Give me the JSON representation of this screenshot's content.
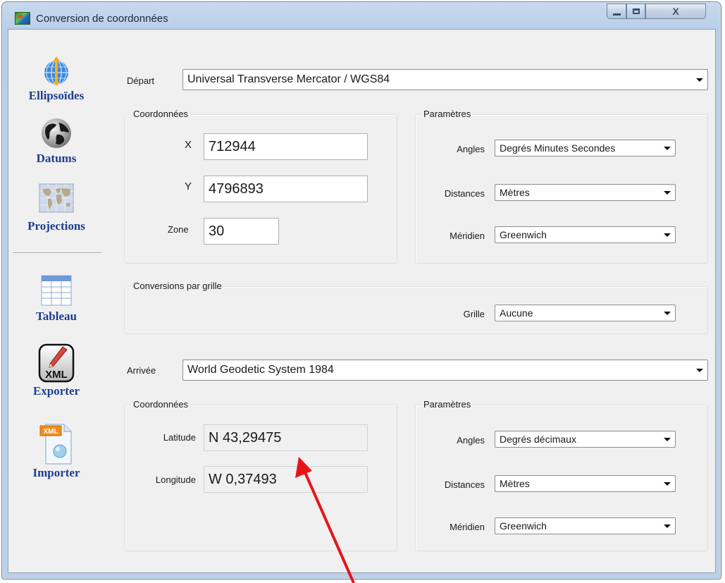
{
  "window": {
    "title": "Conversion de coordonnées",
    "close_glyph": "X"
  },
  "sidebar": {
    "items": [
      {
        "label": "Ellipsoïdes",
        "icon": "globe-axis-icon"
      },
      {
        "label": "Datums",
        "icon": "earth-globe-icon"
      },
      {
        "label": "Projections",
        "icon": "world-map-icon"
      },
      {
        "label": "Tableau",
        "icon": "table-icon"
      },
      {
        "label": "Exporter",
        "icon": "xml-pen-icon"
      },
      {
        "label": "Importer",
        "icon": "xml-document-icon"
      }
    ],
    "xml_badge": "XML",
    "xml_doc_badge": "XML"
  },
  "depart": {
    "label": "Départ",
    "system": "Universal Transverse Mercator / WGS84",
    "coords": {
      "title": "Coordonnées",
      "x_label": "X",
      "x_value": "712944",
      "y_label": "Y",
      "y_value": "4796893",
      "zone_label": "Zone",
      "zone_value": "30"
    },
    "params": {
      "title": "Paramètres",
      "angles_label": "Angles",
      "angles_value": "Degrés Minutes Secondes",
      "distances_label": "Distances",
      "distances_value": "Mètres",
      "meridien_label": "Méridien",
      "meridien_value": "Greenwich"
    }
  },
  "grid": {
    "title": "Conversions par grille",
    "grille_label": "Grille",
    "grille_value": "Aucune"
  },
  "arrivee": {
    "label": "Arrivée",
    "system": "World Geodetic System 1984",
    "coords": {
      "title": "Coordonnées",
      "lat_label": "Latitude",
      "lat_value": "N 43,29475",
      "lon_label": "Longitude",
      "lon_value": "W 0,37493"
    },
    "params": {
      "title": "Paramètres",
      "angles_label": "Angles",
      "angles_value": "Degrés décimaux",
      "distances_label": "Distances",
      "distances_value": "Mètres",
      "meridien_label": "Méridien",
      "meridien_value": "Greenwich"
    }
  },
  "colors": {
    "sidebar_label": "#1c3d8f",
    "annotation_arrow": "#e8141b"
  }
}
